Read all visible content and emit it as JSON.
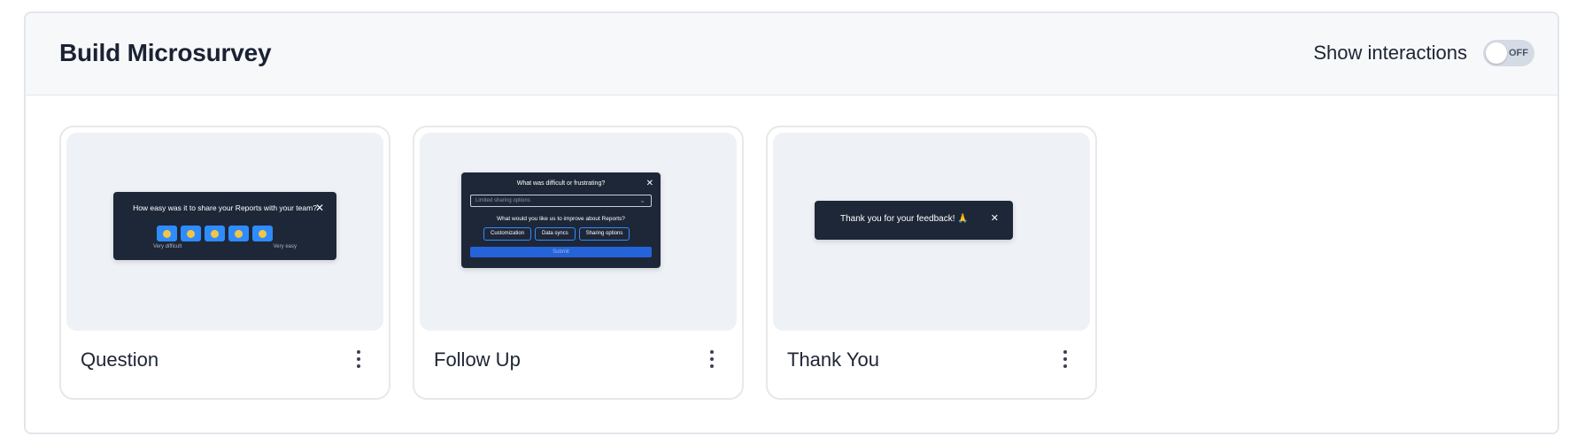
{
  "header": {
    "title": "Build Microsurvey",
    "interactions_label": "Show interactions",
    "toggle_state": "OFF"
  },
  "cards": [
    {
      "title": "Question",
      "widget": {
        "question": "How easy was it to share your Reports with your team?",
        "close": "✕",
        "scale_low": "Very difficult",
        "scale_high": "Very easy",
        "faces": 5
      }
    },
    {
      "title": "Follow Up",
      "widget": {
        "question": "What was difficult or frustrating?",
        "close": "✕",
        "select_value": "Limited sharing options",
        "followup_question": "What would you like us to improve about Reports?",
        "options": [
          "Customization",
          "Data syncs",
          "Sharing options"
        ],
        "submit": "Submit"
      }
    },
    {
      "title": "Thank You",
      "widget": {
        "message": "Thank you for your feedback! 🙏",
        "close": "✕"
      }
    }
  ],
  "colors": {
    "widget_bg": "#1e2738",
    "accent": "#2f8cff",
    "preview_bg": "#eef1f6"
  }
}
